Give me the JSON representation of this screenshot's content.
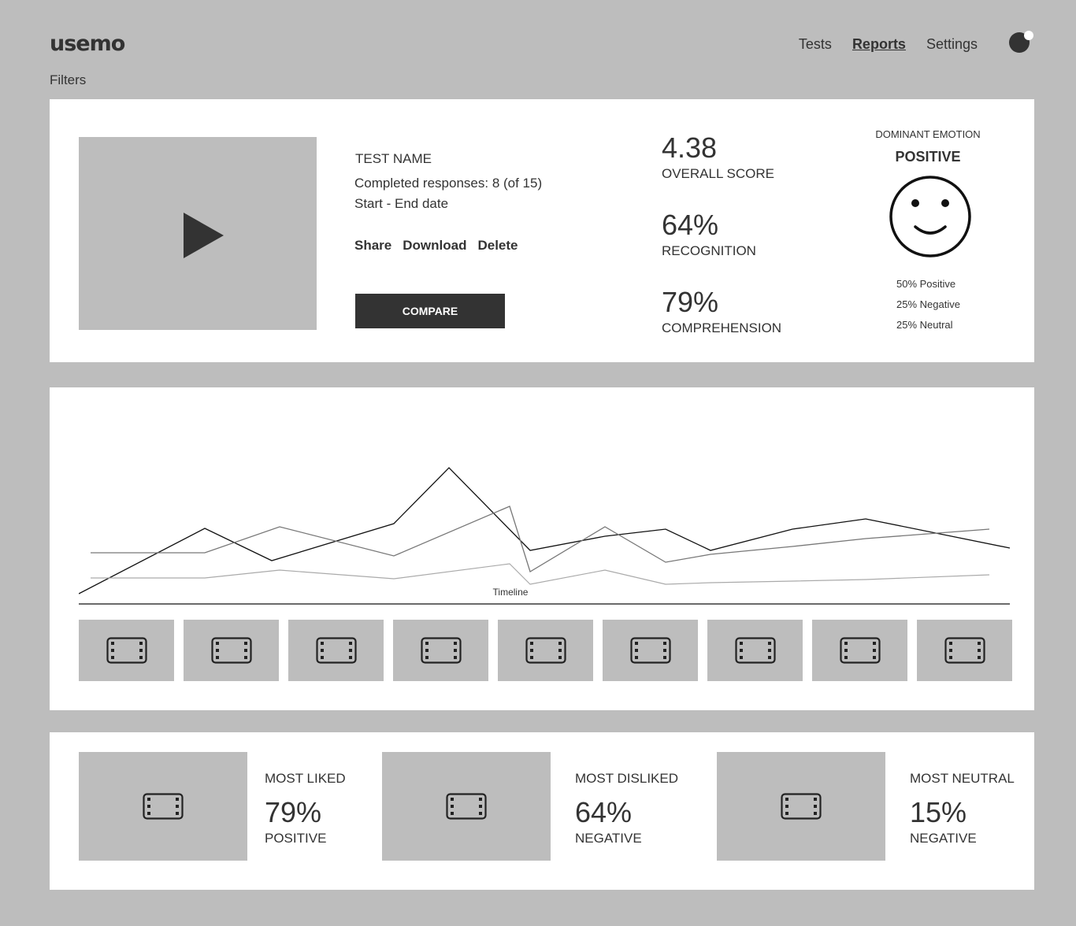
{
  "header": {
    "logo": "usemo",
    "nav": [
      {
        "label": "Tests"
      },
      {
        "label": "Reports"
      },
      {
        "label": "Settings"
      }
    ],
    "filters_label": "Filters"
  },
  "summary": {
    "test_name": "TEST NAME",
    "responses": "Completed responses: 8 (of 15)",
    "dates": "Start - End date",
    "actions": {
      "share": "Share",
      "download": "Download",
      "delete": "Delete"
    },
    "compare_label": "COMPARE",
    "metrics": [
      {
        "value": "4.38",
        "label": "OVERALL SCORE"
      },
      {
        "value": "64%",
        "label": "RECOGNITION"
      },
      {
        "value": "79%",
        "label": "COMPREHENSION"
      }
    ],
    "dominant": {
      "title": "DOMINANT EMOTION",
      "value": "POSITIVE",
      "icon": "smiley-icon",
      "breakdown": [
        "50% Positive",
        "25% Negative",
        "25% Neutral"
      ]
    }
  },
  "timeline": {
    "label": "Timeline",
    "thumbnails": [
      "film-icon",
      "film-icon",
      "film-icon",
      "film-icon",
      "film-icon",
      "film-icon",
      "film-icon",
      "film-icon",
      "film-icon"
    ]
  },
  "highlights": [
    {
      "title": "MOST LIKED",
      "value": "79%",
      "sub": "POSITIVE"
    },
    {
      "title": "MOST DISLIKED",
      "value": "64%",
      "sub": "NEGATIVE"
    },
    {
      "title": "MOST NEUTRAL",
      "value": "15%",
      "sub": "NEGATIVE"
    }
  ],
  "chart_data": {
    "type": "line",
    "title": "",
    "xlabel": "Timeline",
    "ylabel": "",
    "x": [
      0,
      1,
      2,
      3,
      4,
      5,
      6,
      7,
      8,
      9,
      10,
      11,
      12
    ],
    "series": [
      {
        "values": [
          0,
          83,
          42,
          89,
          160,
          55,
          73,
          82,
          55,
          82,
          95,
          58,
          14
        ]
      },
      {
        "values": [
          52,
          52,
          85,
          48,
          111,
          28,
          85,
          40,
          50,
          60,
          70,
          82
        ]
      },
      {
        "values": [
          20,
          20,
          30,
          19,
          38,
          12,
          30,
          12,
          14,
          16,
          18,
          24
        ]
      }
    ],
    "grid": false
  }
}
